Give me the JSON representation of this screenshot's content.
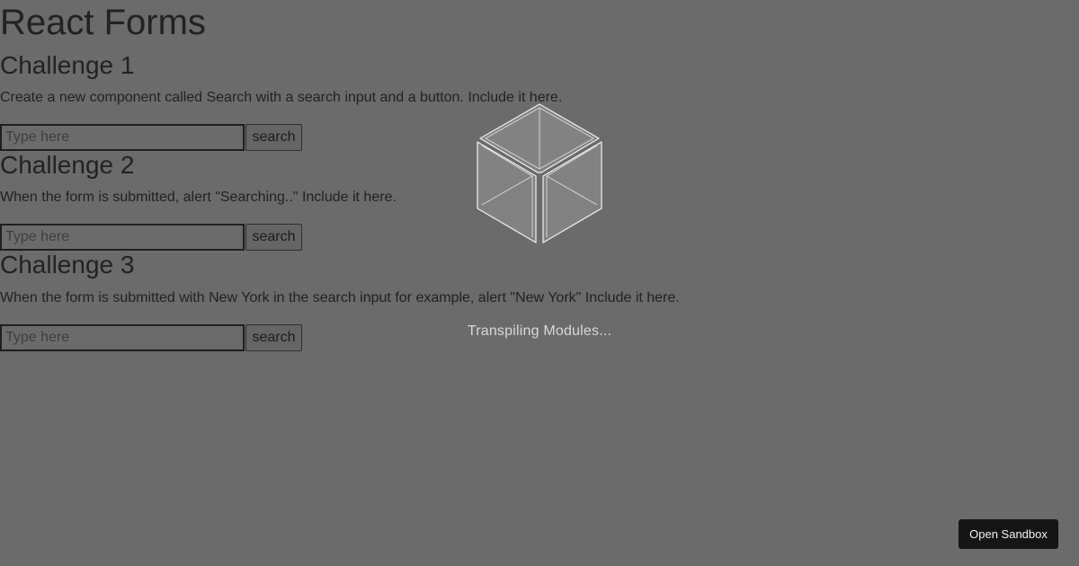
{
  "page": {
    "title": "React Forms"
  },
  "challenges": [
    {
      "heading": "Challenge 1",
      "description": "Create a new component called Search with a search input and a button. Include it here.",
      "input_placeholder": "Type here",
      "input_value": "",
      "button_label": "search"
    },
    {
      "heading": "Challenge 2",
      "description": "When the form is submitted, alert \"Searching..\" Include it here.",
      "input_placeholder": "Type here",
      "input_value": "",
      "button_label": "search"
    },
    {
      "heading": "Challenge 3",
      "description": "When the form is submitted with New York in the search input for example, alert \"New York\" Include it here.",
      "input_placeholder": "Type here",
      "input_value": "",
      "button_label": "search"
    }
  ],
  "overlay": {
    "loader_icon": "codesandbox-cube-icon",
    "status_text": "Transpiling Modules..."
  },
  "open_sandbox": {
    "label": "Open Sandbox"
  },
  "colors": {
    "overlay_background": "#6b6b6b",
    "text": "#222222",
    "status_text": "#d8d8d8",
    "open_sandbox_background": "#151515"
  }
}
